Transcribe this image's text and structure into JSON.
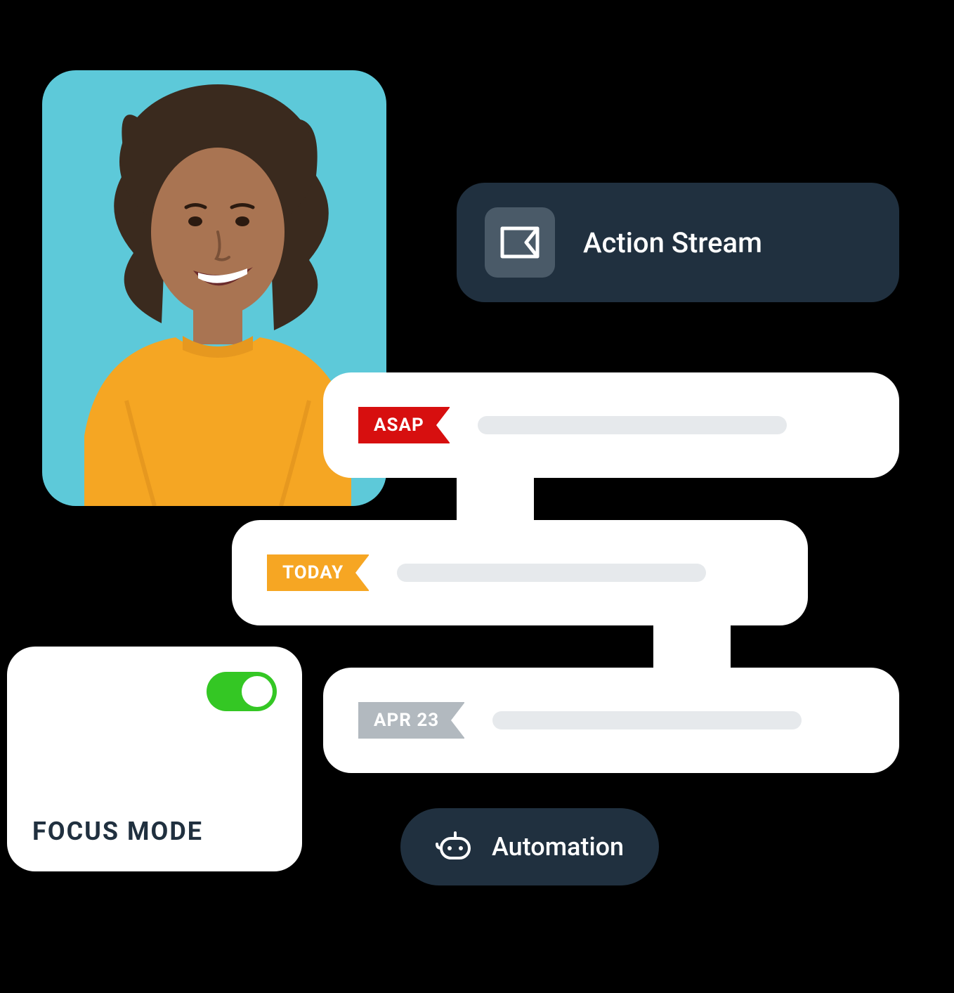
{
  "actionStream": {
    "title": "Action Stream"
  },
  "streamItems": [
    {
      "flag": "ASAP",
      "color": "red"
    },
    {
      "flag": "TODAY",
      "color": "orange"
    },
    {
      "flag": "APR 23",
      "color": "gray"
    }
  ],
  "focus": {
    "label": "FOCUS MODE",
    "enabled": true
  },
  "automation": {
    "label": "Automation"
  },
  "colors": {
    "darkCard": "#20303f",
    "flagRed": "#d70f0f",
    "flagOrange": "#f6a623",
    "flagGray": "#b2b9bf",
    "toggleGreen": "#34c724",
    "photoBg": "#5dc9d9"
  }
}
